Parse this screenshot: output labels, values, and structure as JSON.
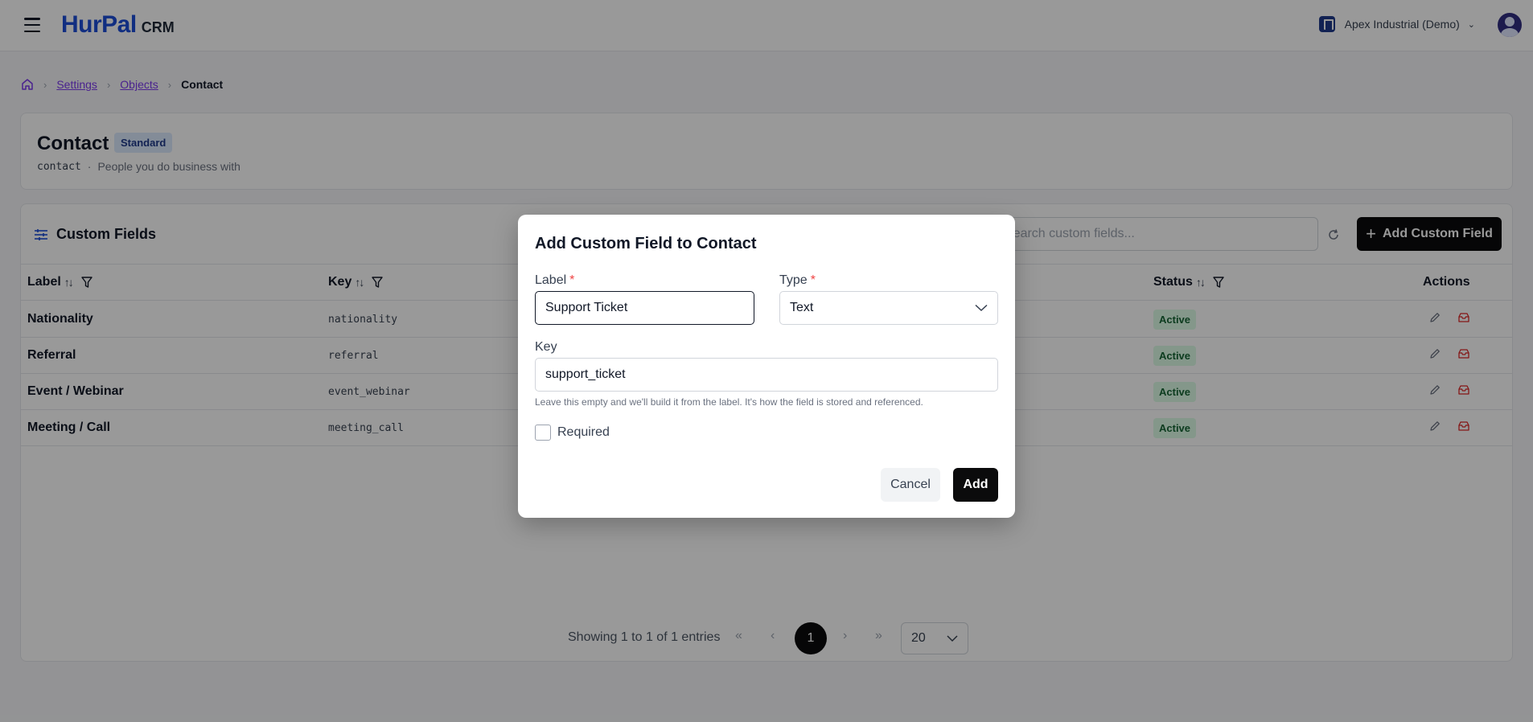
{
  "header": {
    "logo_main": "HurPal",
    "logo_sub": "CRM",
    "org_name": "Apex Industrial (Demo)"
  },
  "breadcrumb": {
    "items": [
      "Settings",
      "Objects"
    ],
    "current": "Contact"
  },
  "object": {
    "title": "Contact",
    "badge": "Standard",
    "key": "contact",
    "separator": "·",
    "description": "People you do business with"
  },
  "fields": {
    "title": "Custom Fields",
    "search_placeholder": "Search custom fields...",
    "add_button": "Add Custom Field",
    "add_icon": "+",
    "columns": {
      "label": "Label",
      "key": "Key",
      "status": "Status",
      "actions": "Actions"
    },
    "rows": [
      {
        "label": "Nationality",
        "key": "nationality",
        "status": "Active"
      },
      {
        "label": "Referral",
        "key": "referral",
        "status": "Active"
      },
      {
        "label": "Event / Webinar",
        "key": "event_webinar",
        "status": "Active"
      },
      {
        "label": "Meeting / Call",
        "key": "meeting_call",
        "status": "Active"
      }
    ],
    "pager": {
      "summary": "Showing 1 to 1 of 1 entries",
      "first": "«",
      "prev": "‹",
      "current": "1",
      "next": "›",
      "last": "»",
      "page_size": "20"
    }
  },
  "modal": {
    "title": "Add Custom Field to Contact",
    "label_field": {
      "label": "Label",
      "required_mark": "*",
      "value": "Support Ticket"
    },
    "type_field": {
      "label": "Type",
      "required_mark": "*",
      "value": "Text"
    },
    "key_field": {
      "label": "Key",
      "value": "support_ticket",
      "help": "Leave this empty and we'll build it from the label. It's how the field is stored and referenced."
    },
    "required_label": "Required",
    "required_checked": false,
    "cancel_button": "Cancel",
    "add_button": "Add"
  },
  "icons": {
    "menu": "hamburger-icon",
    "home": "home-icon",
    "sort": "sort-icon",
    "filter": "filter-icon",
    "edit": "pencil-icon",
    "delete": "trash-icon",
    "refresh": "refresh-icon"
  },
  "colors": {
    "brand": "#1d4ed8",
    "primary_button": "#0b0b0c",
    "active_badge_bg": "#dcfce7",
    "active_badge_text": "#166534",
    "required": "#ef4444"
  }
}
